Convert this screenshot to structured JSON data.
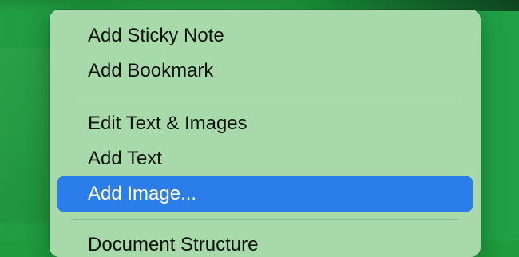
{
  "context_menu": {
    "groups": [
      {
        "items": [
          {
            "label": "Add Sticky Note"
          },
          {
            "label": "Add Bookmark"
          }
        ]
      },
      {
        "items": [
          {
            "label": "Edit Text & Images"
          },
          {
            "label": "Add Text"
          },
          {
            "label": "Add Image...",
            "highlighted": true
          }
        ]
      },
      {
        "items": [
          {
            "label": "Document Structure"
          }
        ]
      }
    ]
  },
  "colors": {
    "highlight": "#2b7ee9",
    "menu_background": "#a7d9aa",
    "desktop_background": "#1f9a3c"
  }
}
